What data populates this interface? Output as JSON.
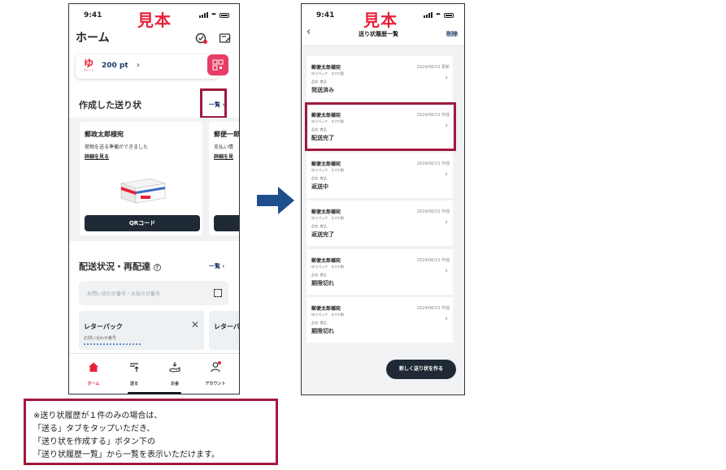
{
  "phone1": {
    "time": "9:41",
    "sample_label": "見本",
    "title": "ホーム",
    "points": {
      "value": "200 pt",
      "logo_mark": "ゆ",
      "logo_sub": "ポイント"
    },
    "created_labels": {
      "title": "作成した送り状",
      "link": "一覧 ›"
    },
    "cards": [
      {
        "name": "郵政太郎様宛",
        "message": "荷物を送る準備ができました",
        "detail": "詳細を見る",
        "button": "QRコード"
      },
      {
        "name": "郵便一郎",
        "message": "支払い情",
        "detail": "詳細を見"
      }
    ],
    "delivery": {
      "title": "配送状況・再配達",
      "link": "一覧 ›",
      "placeholder": "お問い合わせ番号・お知らせ番号"
    },
    "letterpacks": [
      {
        "title": "レターパック",
        "sub": "お問い合わせ番号"
      },
      {
        "title": "レターパ"
      }
    ],
    "tabs": [
      {
        "label": "ホーム"
      },
      {
        "label": "送る"
      },
      {
        "label": "お金"
      },
      {
        "label": "アカウント"
      }
    ]
  },
  "phone2": {
    "time": "9:41",
    "sample_label": "見本",
    "title": "送り状履歴一覧",
    "delete_label": "削除",
    "items": [
      {
        "name": "郵便太郎様宛",
        "service": "ゆうパック　スマホ割",
        "date": "2024/06/15 更新",
        "category": "品名: 食品",
        "status": "発送済み"
      },
      {
        "name": "郵便太郎様宛",
        "service": "ゆうパック　スマホ割",
        "date": "2024/06/15 作成",
        "category": "品名: 食品",
        "status": "配送完了"
      },
      {
        "name": "郵便太郎様宛",
        "service": "ゆうパック　スマホ割",
        "date": "2024/06/15 作成",
        "category": "品名: 食品",
        "status": "返送中"
      },
      {
        "name": "郵便太郎様宛",
        "service": "ゆうパック　スマホ割",
        "date": "2024/06/15 作成",
        "category": "品名: 食品",
        "status": "返送完了"
      },
      {
        "name": "郵便太郎様宛",
        "service": "ゆうパック　スマホ割",
        "date": "2024/06/15 作成",
        "category": "品名: 食品",
        "status": "期限切れ"
      },
      {
        "name": "郵便太郎様宛",
        "service": "ゆうパック　スマホ割",
        "date": "2024/06/15 作成",
        "category": "品名: 食品",
        "status": "期限切れ"
      }
    ],
    "new_button": "新しく送り状を作る"
  },
  "note": {
    "lines": [
      "※送り状履歴が１件のみの場合は、",
      "「送る」タブをタップいただき、",
      "「送り状を作成する」ボタン下の",
      "「送り状履歴一覧」から一覧を表示いただけます。"
    ]
  },
  "colors": {
    "accent_red": "#e8213a",
    "frame_red": "#a0193c",
    "navy": "#1e3a66",
    "arrow_blue": "#1f4e8c",
    "dark_button": "#1f2a36"
  }
}
